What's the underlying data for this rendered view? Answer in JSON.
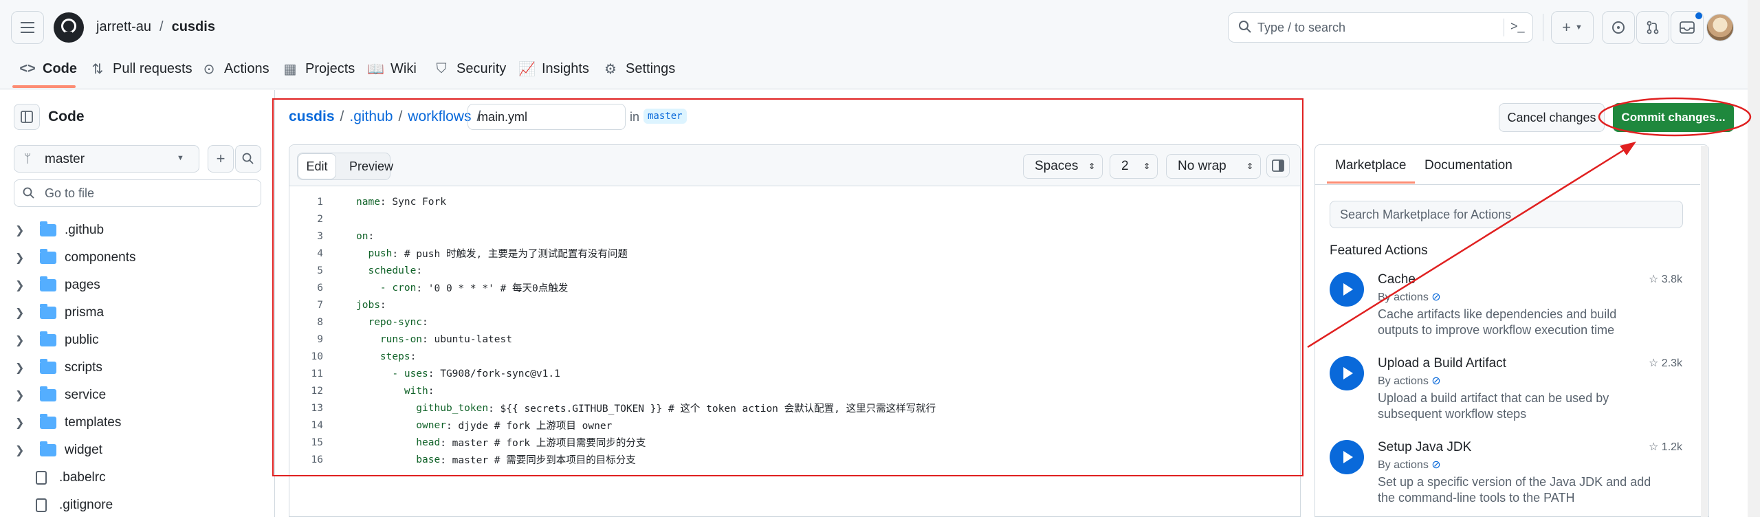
{
  "header": {
    "owner": "jarrett-au",
    "separator": "/",
    "repo": "cusdis",
    "search_text": "Type / to search",
    "tabs": [
      {
        "label": "Code",
        "icon": "code-icon"
      },
      {
        "label": "Pull requests",
        "icon": "pull-request-icon"
      },
      {
        "label": "Actions",
        "icon": "play-circle-icon"
      },
      {
        "label": "Projects",
        "icon": "table-icon"
      },
      {
        "label": "Wiki",
        "icon": "book-icon"
      },
      {
        "label": "Security",
        "icon": "shield-icon"
      },
      {
        "label": "Insights",
        "icon": "graph-icon"
      },
      {
        "label": "Settings",
        "icon": "gear-icon"
      }
    ]
  },
  "sidebar": {
    "title": "Code",
    "branch": "master",
    "file_filter_placeholder": "Go to file",
    "items": [
      {
        "name": ".github",
        "type": "folder"
      },
      {
        "name": "components",
        "type": "folder"
      },
      {
        "name": "pages",
        "type": "folder"
      },
      {
        "name": "prisma",
        "type": "folder"
      },
      {
        "name": "public",
        "type": "folder"
      },
      {
        "name": "scripts",
        "type": "folder"
      },
      {
        "name": "service",
        "type": "folder"
      },
      {
        "name": "templates",
        "type": "folder"
      },
      {
        "name": "widget",
        "type": "folder"
      },
      {
        "name": ".babelrc",
        "type": "file"
      },
      {
        "name": ".gitignore",
        "type": "file"
      }
    ]
  },
  "editor": {
    "breadcrumb": [
      "cusdis",
      ".github",
      "workflows"
    ],
    "filename": "main.yml",
    "in_label": "in",
    "branch_badge": "master",
    "cancel_label": "Cancel changes",
    "commit_label": "Commit changes...",
    "edit_tab": "Edit",
    "preview_tab": "Preview",
    "indent_mode": "Spaces",
    "indent_size": "2",
    "wrap_mode": "No wrap",
    "lines": [
      {
        "n": "1",
        "key": "name",
        "rest": ": Sync Fork"
      },
      {
        "n": "2",
        "key": "",
        "rest": ""
      },
      {
        "n": "3",
        "key": "on",
        "rest": ":"
      },
      {
        "n": "4",
        "key": "  push",
        "rest": ": # push 时触发, 主要是为了测试配置有没有问题"
      },
      {
        "n": "5",
        "key": "  schedule",
        "rest": ":"
      },
      {
        "n": "6",
        "key": "    - cron",
        "rest": ": '0 0 * * *' # 每天0点触发"
      },
      {
        "n": "7",
        "key": "jobs",
        "rest": ":"
      },
      {
        "n": "8",
        "key": "  repo-sync",
        "rest": ":"
      },
      {
        "n": "9",
        "key": "    runs-on",
        "rest": ": ubuntu-latest"
      },
      {
        "n": "10",
        "key": "    steps",
        "rest": ":"
      },
      {
        "n": "11",
        "key": "      - uses",
        "rest": ": TG908/fork-sync@v1.1"
      },
      {
        "n": "12",
        "key": "        with",
        "rest": ":"
      },
      {
        "n": "13",
        "key": "          github_token",
        "rest": ": ${{ secrets.GITHUB_TOKEN }} # 这个 token action 会默认配置, 这里只需这样写就行"
      },
      {
        "n": "14",
        "key": "          owner",
        "rest": ": djyde # fork 上游项目 owner"
      },
      {
        "n": "15",
        "key": "          head",
        "rest": ": master # fork 上游项目需要同步的分支"
      },
      {
        "n": "16",
        "key": "          base",
        "rest": ": master # 需要同步到本项目的目标分支"
      }
    ]
  },
  "panel": {
    "tab_marketplace": "Marketplace",
    "tab_documentation": "Documentation",
    "search_placeholder": "Search Marketplace for Actions",
    "featured_heading": "Featured Actions",
    "actions": [
      {
        "title": "Cache",
        "by": "By actions",
        "stars": "3.8k",
        "desc": "Cache artifacts like dependencies and build outputs to improve workflow execution time"
      },
      {
        "title": "Upload a Build Artifact",
        "by": "By actions",
        "stars": "2.3k",
        "desc": "Upload a build artifact that can be used by subsequent workflow steps"
      },
      {
        "title": "Setup Java JDK",
        "by": "By actions",
        "stars": "1.2k",
        "desc": "Set up a specific version of the Java JDK and add the command-line tools to the PATH"
      }
    ]
  },
  "colors": {
    "accent": "#1f883d",
    "annotation": "#e02020",
    "link": "#0969da"
  }
}
